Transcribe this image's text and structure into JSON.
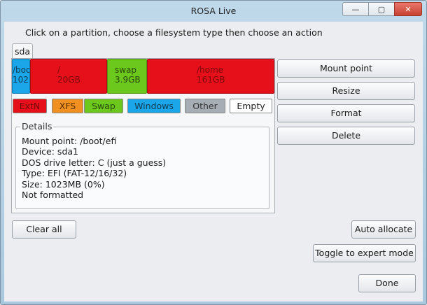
{
  "window": {
    "title": "ROSA Live",
    "minimize_label": "—",
    "maximize_label": "▢",
    "close_label": "✕"
  },
  "instruction": "Click on a partition, choose a filesystem type then choose an action",
  "disk_tab": "sda",
  "partitions": [
    {
      "name": "/boo",
      "size": "102",
      "color": "#1aa6e8",
      "text_color": "#0f3c55"
    },
    {
      "name": "/",
      "size": "20GB",
      "color": "#e5101a",
      "text_color": "#7a0a0a"
    },
    {
      "name": "swap",
      "size": "3.9GB",
      "color": "#6cc81c",
      "text_color": "#2a4a08"
    },
    {
      "name": "/home",
      "size": "161GB",
      "color": "#e5101a",
      "text_color": "#7a0a0a"
    }
  ],
  "legend": [
    {
      "label": "ExtN",
      "color": "#e5101a",
      "text_color": "#7a0a0a"
    },
    {
      "label": "XFS",
      "color": "#f09020",
      "text_color": "#5a3000"
    },
    {
      "label": "Swap",
      "color": "#6cc81c",
      "text_color": "#2a4a08"
    },
    {
      "label": "Windows",
      "color": "#1aa6e8",
      "text_color": "#0f3c55"
    },
    {
      "label": "Other",
      "color": "#a7adb4",
      "text_color": "#333333"
    },
    {
      "label": "Empty",
      "color": "#ffffff",
      "text_color": "#222222"
    }
  ],
  "details": {
    "title": "Details",
    "lines": [
      "Mount point: /boot/efi",
      "Device: sda1",
      "DOS drive letter: C (just a guess)",
      "Type: EFI (FAT-12/16/32)",
      "Size: 1023MB (0%)",
      "Not formatted"
    ]
  },
  "actions": {
    "mount_point": "Mount point",
    "resize": "Resize",
    "format": "Format",
    "delete": "Delete"
  },
  "footer": {
    "clear_all": "Clear all",
    "auto_allocate": "Auto allocate",
    "toggle_expert": "Toggle to expert mode",
    "done": "Done"
  }
}
